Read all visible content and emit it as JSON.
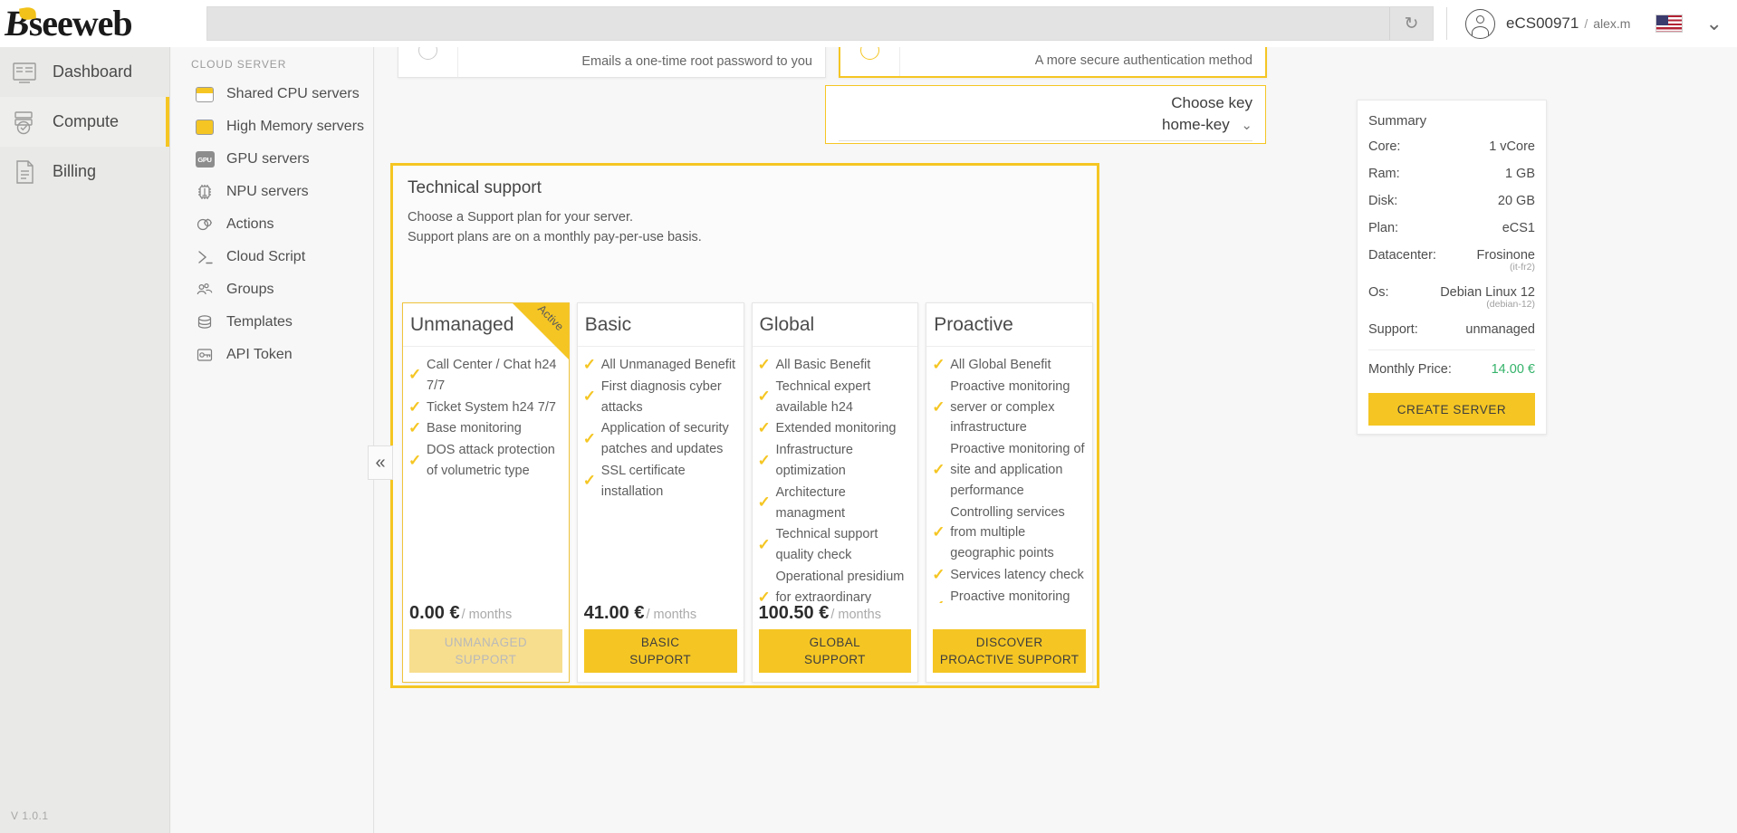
{
  "topbar": {
    "brand": "seeweb",
    "search_value": "",
    "search_placeholder": "",
    "refresh_icon": "refresh-icon",
    "account_name": "eCS00971",
    "account_separator": "/",
    "account_user": "alex.m",
    "flag_icon": "us-flag-icon",
    "lang_chevron": "⌄"
  },
  "leftnav": {
    "items": [
      {
        "label": "Dashboard",
        "icon": "dashboard-icon",
        "active": false
      },
      {
        "label": "Compute",
        "icon": "servers-icon",
        "active": true
      },
      {
        "label": "Billing",
        "icon": "document-icon",
        "active": false
      }
    ],
    "version": "V 1.0.1"
  },
  "subnav": {
    "title": "CLOUD SERVER",
    "items": [
      {
        "label": "Shared CPU servers",
        "icon": "chip-hollow-icon"
      },
      {
        "label": "High Memory servers",
        "icon": "chip-filled-icon"
      },
      {
        "label": "GPU servers",
        "icon": "gpu-chip-icon"
      },
      {
        "label": "NPU servers",
        "icon": "npu-chip-icon"
      },
      {
        "label": "Actions",
        "icon": "actions-gear-icon"
      },
      {
        "label": "Cloud Script",
        "icon": "terminal-icon"
      },
      {
        "label": "Groups",
        "icon": "groups-icon"
      },
      {
        "label": "Templates",
        "icon": "templates-icon"
      },
      {
        "label": "API Token",
        "icon": "api-token-icon"
      }
    ]
  },
  "collapse_handle": "«",
  "auth": {
    "cards": [
      {
        "description": "Emails a one-time root password to you",
        "selected": false
      },
      {
        "description": "A more secure authentication method",
        "selected": true
      }
    ]
  },
  "choose_key": {
    "title": "Choose key",
    "selected": "home-key",
    "chevron": "⌄"
  },
  "technical_support": {
    "heading": "Technical support",
    "subtitle_1": "Choose a Support plan for your server.",
    "subtitle_2": "Support plans are on a monthly pay-per-use basis.",
    "plans": [
      {
        "name": "Unmanaged",
        "badge": "Active",
        "active": true,
        "features": [
          "Call Center / Chat h24 7/7",
          "Ticket System h24 7/7",
          "Base monitoring",
          "DOS attack protection of volumetric type"
        ],
        "price": "0.00 €",
        "price_per": "/ months",
        "button_line1": "UNMANAGED",
        "button_line2": "SUPPORT",
        "button_disabled": true
      },
      {
        "name": "Basic",
        "badge": "",
        "active": false,
        "features": [
          "All Unmanaged Benefit",
          "First diagnosis cyber attacks",
          "Application of security patches and updates",
          "SSL certificate installation"
        ],
        "price": "41.00 €",
        "price_per": "/ months",
        "button_line1": "BASIC",
        "button_line2": "SUPPORT",
        "button_disabled": false
      },
      {
        "name": "Global",
        "badge": "",
        "active": false,
        "features": [
          "All Basic Benefit",
          "Technical expert available h24",
          "Extended monitoring",
          "Infrastructure optimization",
          "Architecture managment",
          "Technical support quality check",
          "Operational presidium for extraordinary occasions"
        ],
        "price": "100.50 €",
        "price_per": "/ months",
        "button_line1": "GLOBAL",
        "button_line2": "SUPPORT",
        "button_disabled": false
      },
      {
        "name": "Proactive",
        "badge": "",
        "active": false,
        "features": [
          "All Global Benefit",
          "Proactive monitoring server or complex infrastructure",
          "Proactive monitoring of site and application performance",
          "Controlling services from multiple geographic points",
          "Services latency check",
          "Proactive monitoring dashboard"
        ],
        "price": "",
        "price_per": "",
        "button_line1": "DISCOVER",
        "button_line2": "PROACTIVE SUPPORT",
        "button_disabled": false
      }
    ]
  },
  "summary": {
    "title": "Summary",
    "rows": [
      {
        "key": "Core:",
        "value": "1 vCore",
        "sub": ""
      },
      {
        "key": "Ram:",
        "value": "1 GB",
        "sub": ""
      },
      {
        "key": "Disk:",
        "value": "20 GB",
        "sub": ""
      },
      {
        "key": "Plan:",
        "value": "eCS1",
        "sub": ""
      },
      {
        "key": "Datacenter:",
        "value": "Frosinone",
        "sub": "(it-fr2)"
      },
      {
        "key": "Os:",
        "value": "Debian Linux 12",
        "sub": "(debian-12)"
      },
      {
        "key": "Support:",
        "value": "unmanaged",
        "sub": ""
      }
    ],
    "price_key": "Monthly Price:",
    "price_value": "14.00 €",
    "create_label": "CREATE SERVER"
  },
  "colors": {
    "accent": "#f5c623",
    "accent_soft": "#f7de8e",
    "price_green": "#35b36a",
    "text": "#4d4d4d",
    "muted": "#9b9b9b"
  }
}
